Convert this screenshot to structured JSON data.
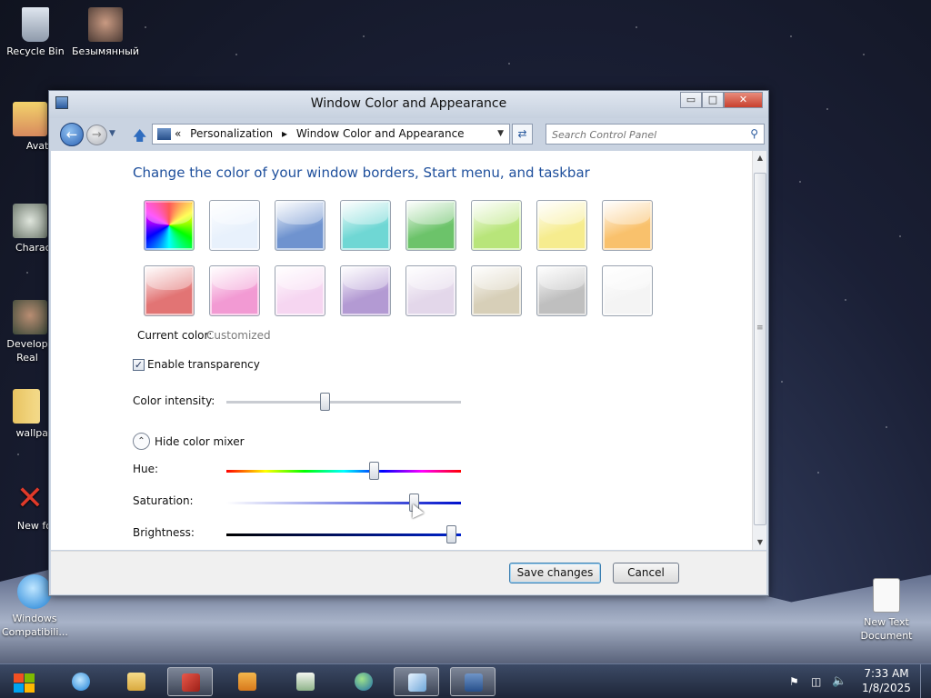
{
  "desktop": {
    "icons": [
      {
        "label": "Recycle Bin"
      },
      {
        "label": "Безымянный"
      },
      {
        "label": "Avata"
      },
      {
        "label": "Charact"
      },
      {
        "label": "Develop Real"
      },
      {
        "label": "wallpap"
      },
      {
        "label": "New fol"
      },
      {
        "label": "Windows Compatibili..."
      },
      {
        "label": "New Text Document"
      }
    ]
  },
  "window": {
    "title": "Window Color and Appearance",
    "caption_buttons": {
      "minimize": "▭",
      "maximize": "□",
      "close": "✕"
    },
    "address": {
      "prefix": "«",
      "crumbs": [
        "Personalization",
        "▸",
        "Window Color and Appearance"
      ]
    },
    "search": {
      "placeholder": "Search Control Panel"
    },
    "heading": "Change the color of your window borders, Start menu, and taskbar",
    "swatches": [
      {
        "name": "rainbow",
        "color": "#ff0000"
      },
      {
        "name": "sky",
        "color": "#e8f1fc"
      },
      {
        "name": "twilight",
        "color": "#6f93cf"
      },
      {
        "name": "sea-foam",
        "color": "#6fd7d4"
      },
      {
        "name": "leaf",
        "color": "#6cc36a"
      },
      {
        "name": "lime",
        "color": "#b8e57a"
      },
      {
        "name": "lemon",
        "color": "#f6ec8e"
      },
      {
        "name": "pumpkin",
        "color": "#f9c16c"
      },
      {
        "name": "ruby",
        "color": "#e27474"
      },
      {
        "name": "fuchsia",
        "color": "#f29ad3"
      },
      {
        "name": "blush",
        "color": "#f6d6f1"
      },
      {
        "name": "violet",
        "color": "#b39ad3"
      },
      {
        "name": "lavender",
        "color": "#e3d7ea"
      },
      {
        "name": "taupe",
        "color": "#d7cfb8"
      },
      {
        "name": "chocolate",
        "color": "#bfbfbf"
      },
      {
        "name": "frost",
        "color": "#f4f4f4"
      }
    ],
    "current_color_label": "Current color:",
    "current_color_value": "Customized",
    "enable_transparency_label": "Enable transparency",
    "enable_transparency_checked": true,
    "color_intensity_label": "Color intensity:",
    "color_intensity_level": 0.42,
    "hide_mixer_label": "Hide color mixer",
    "hue_label": "Hue:",
    "hue_level": 0.63,
    "saturation_label": "Saturation:",
    "saturation_level": 0.8,
    "brightness_label": "Brightness:",
    "brightness_level": 0.96,
    "save_button": "Save changes",
    "cancel_button": "Cancel"
  },
  "taskbar": {
    "clock_time": "7:33 AM",
    "clock_date": "1/8/2025"
  }
}
